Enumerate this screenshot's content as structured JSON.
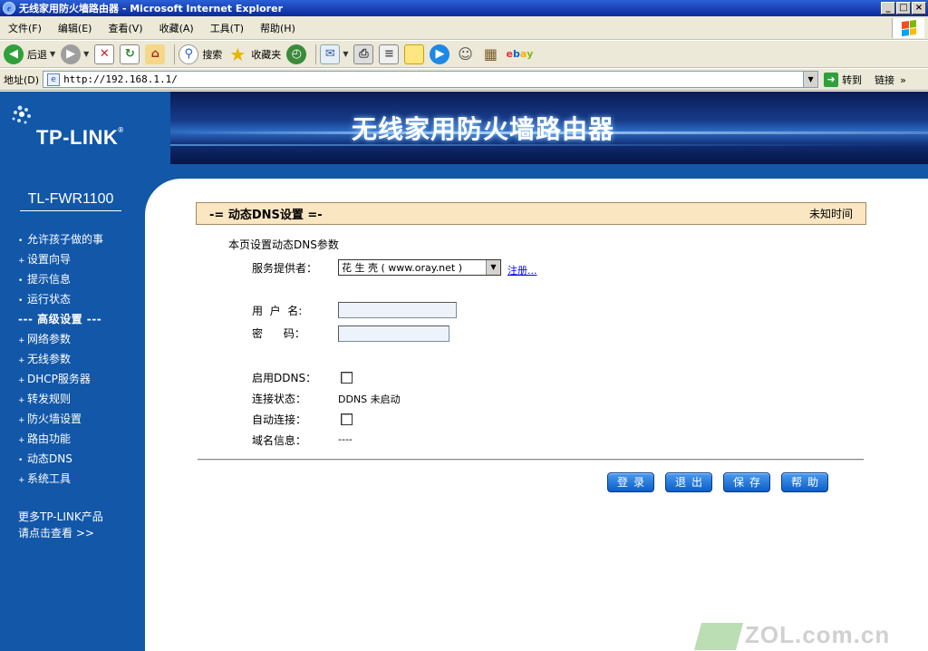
{
  "window": {
    "title": "无线家用防火墙路由器 - Microsoft Internet Explorer",
    "controls": [
      "_",
      "□",
      "×"
    ]
  },
  "menu": [
    "文件(F)",
    "编辑(E)",
    "查看(V)",
    "收藏(A)",
    "工具(T)",
    "帮助(H)"
  ],
  "toolbar": {
    "back": "后退",
    "search": "搜索",
    "favorites": "收藏夹"
  },
  "address": {
    "label": "地址(D)",
    "url": "http://192.168.1.1/",
    "go": "转到",
    "links": "链接"
  },
  "banner": {
    "logo": "TP-LINK",
    "title": "无线家用防火墙路由器"
  },
  "sidebar": {
    "model": "TL-FWR1100",
    "items": [
      {
        "bullet": "•",
        "label": "允许孩子做的事"
      },
      {
        "bullet": "+",
        "label": "设置向导"
      },
      {
        "bullet": "•",
        "label": "提示信息"
      },
      {
        "bullet": "•",
        "label": "运行状态"
      },
      {
        "bullet": "",
        "label": "--- 高级设置 ---"
      },
      {
        "bullet": "+",
        "label": "网络参数"
      },
      {
        "bullet": "+",
        "label": "无线参数"
      },
      {
        "bullet": "+",
        "label": "DHCP服务器"
      },
      {
        "bullet": "+",
        "label": "转发规则"
      },
      {
        "bullet": "+",
        "label": "防火墙设置"
      },
      {
        "bullet": "+",
        "label": "路由功能"
      },
      {
        "bullet": "•",
        "label": "动态DNS"
      },
      {
        "bullet": "+",
        "label": "系统工具"
      }
    ],
    "more_line1": "更多TP-LINK产品",
    "more_line2": "请点击查看 >>"
  },
  "main": {
    "title": "-= 动态DNS设置 =-",
    "time": "未知时间",
    "intro": "本页设置动态DNS参数",
    "provider_label": "服务提供者：",
    "provider_value": "花 生 壳 ( www.oray.net )",
    "register_link": "注册...",
    "username_label": "用  户  名:",
    "password_label": "密      码：",
    "enable_ddns_label": "启用DDNS：",
    "connection_status_label": "连接状态：",
    "connection_status_value": "DDNS 未启动",
    "auto_connect_label": "自动连接：",
    "domain_info_label": "域名信息：",
    "domain_info_value": "----",
    "buttons": {
      "login": "登录",
      "logout": "退出",
      "save": "保存",
      "help": "帮助"
    }
  },
  "watermark": "ZOL.com.cn"
}
